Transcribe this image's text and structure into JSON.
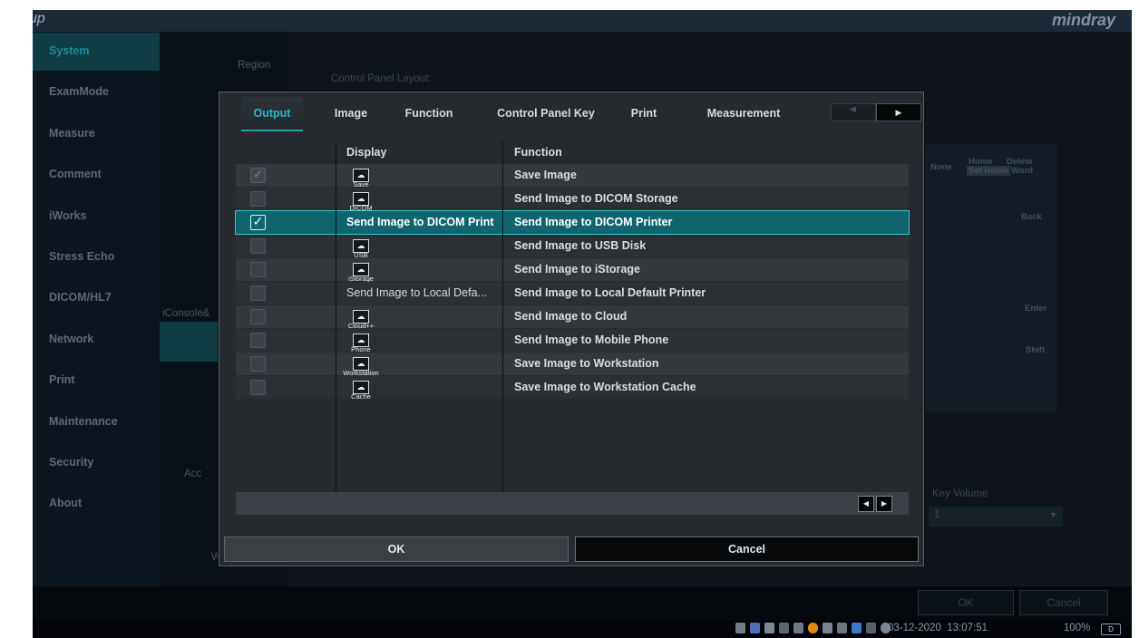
{
  "window": {
    "title": "Setup",
    "brand": "mindray"
  },
  "sidebar": {
    "items": [
      {
        "label": "System",
        "icon": "gear-icon"
      },
      {
        "label": "ExamMode",
        "icon": "probe-icon"
      },
      {
        "label": "Measure",
        "icon": "caliper-icon"
      },
      {
        "label": "Comment",
        "icon": "comment-icon"
      },
      {
        "label": "iWorks",
        "icon": "checklist-icon"
      },
      {
        "label": "Stress Echo",
        "icon": "heart-icon"
      },
      {
        "label": "DICOM/HL7",
        "icon": "dicom-icon"
      },
      {
        "label": "Network",
        "icon": "network-icon"
      },
      {
        "label": "Print",
        "icon": "printer-icon"
      },
      {
        "label": "Maintenance",
        "icon": "tools-icon"
      },
      {
        "label": "Security",
        "icon": "shield-icon"
      },
      {
        "label": "About",
        "icon": "info-icon"
      }
    ]
  },
  "middle": {
    "region_label": "Region",
    "iconsole_label": "iConsole&",
    "acc_label": "Acc",
    "w_label": "W"
  },
  "background": {
    "control_panel_layout_label": "Control Panel Layout:",
    "key_volume_label": "Key Volume",
    "key_volume_value": "1",
    "keyboard": {
      "home": "Home",
      "set_home": "Set Home",
      "delete": "Delete",
      "word": "Word",
      "none": "None",
      "back": "Back",
      "enter": "Enter",
      "shift": "Shift"
    },
    "ok": "OK",
    "cancel": "Cancel"
  },
  "dialog": {
    "tabs": [
      "Output",
      "Image",
      "Function",
      "Control Panel Key",
      "Print",
      "Measurement"
    ],
    "active_tab": "Output",
    "columns": {
      "display": "Display",
      "function": "Function"
    },
    "rows": [
      {
        "checked": true,
        "disabled": true,
        "display_icon": "Save",
        "display_text": "",
        "function": "Save Image"
      },
      {
        "checked": false,
        "disabled": false,
        "display_icon": "DICOM",
        "display_text": "",
        "function": "Send Image to DICOM Storage"
      },
      {
        "checked": true,
        "disabled": false,
        "display_icon": "",
        "display_text": "Send Image to DICOM Print",
        "function": "Send Image to DICOM Printer",
        "selected": true
      },
      {
        "checked": false,
        "disabled": false,
        "display_icon": "USB",
        "display_text": "",
        "function": "Send Image to USB Disk"
      },
      {
        "checked": false,
        "disabled": false,
        "display_icon": "iStorage",
        "display_text": "",
        "function": "Send Image to iStorage"
      },
      {
        "checked": false,
        "disabled": false,
        "display_icon": "",
        "display_text": "Send Image to Local Defa...",
        "function": "Send Image to Local Default Printer"
      },
      {
        "checked": false,
        "disabled": false,
        "display_icon": "Cloud++",
        "display_text": "",
        "function": "Send Image to Cloud"
      },
      {
        "checked": false,
        "disabled": false,
        "display_icon": "Phone",
        "display_text": "",
        "function": "Send Image to Mobile Phone"
      },
      {
        "checked": false,
        "disabled": false,
        "display_icon": "Workstation",
        "display_text": "",
        "function": "Save Image to Workstation"
      },
      {
        "checked": false,
        "disabled": false,
        "display_icon": "Cache",
        "display_text": "",
        "function": "Save Image to Workstation Cache"
      }
    ],
    "ok_label": "OK",
    "cancel_label": "Cancel"
  },
  "status": {
    "datetime": "03-12-2020  13:07:51",
    "zoom": "100%",
    "battery": "D"
  },
  "colors": {
    "accent": "#1e9fb0",
    "selected_row": "#0f6470",
    "nav_active": "#103c44"
  }
}
